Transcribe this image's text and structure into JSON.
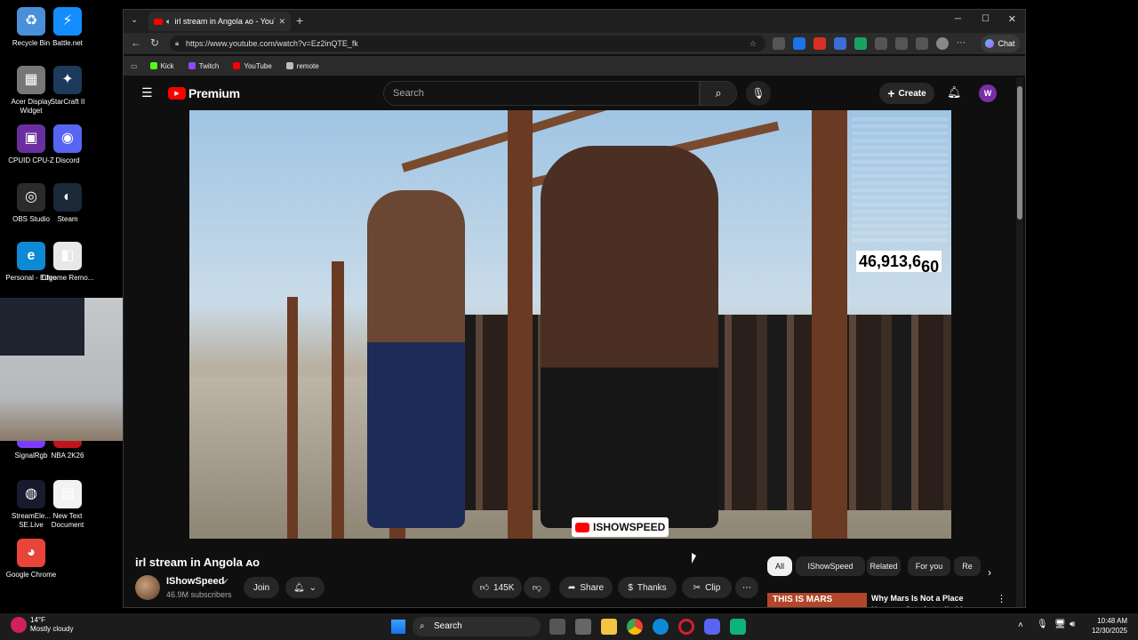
{
  "desktop": {
    "icons": [
      {
        "label": "Recycle Bin",
        "glyph": "♻",
        "color": "#4a90d9"
      },
      {
        "label": "Battle.net",
        "glyph": "⚡",
        "color": "#148eff"
      },
      {
        "label": "Acer Display Widget",
        "glyph": "▦",
        "color": "#777777"
      },
      {
        "label": "StarCraft II",
        "glyph": "✦",
        "color": "#1b3a5c"
      },
      {
        "label": "CPUID CPU-Z",
        "glyph": "▣",
        "color": "#6a2ea0"
      },
      {
        "label": "Discord",
        "glyph": "◉",
        "color": "#5865f2"
      },
      {
        "label": "OBS Studio",
        "glyph": "◎",
        "color": "#2b2b2b"
      },
      {
        "label": "Steam",
        "glyph": "◐",
        "color": "#1b2838"
      },
      {
        "label": "Personal - Edge",
        "glyph": "e",
        "color": "#0c8ad6"
      },
      {
        "label": "Chrome Remo...",
        "glyph": "◧",
        "color": "#e8e8e8"
      },
      {
        "label": "SignalRgb",
        "glyph": "◆",
        "color": "#7a3cff"
      },
      {
        "label": "NBA 2K26",
        "glyph": "▲",
        "color": "#c0141c"
      },
      {
        "label": "StreamEle... SE.Live",
        "glyph": "◍",
        "color": "#1a1a2e"
      },
      {
        "label": "New Text Document",
        "glyph": "▤",
        "color": "#f2f2f2"
      },
      {
        "label": "Google Chrome",
        "glyph": "◕",
        "color": "#e9443a"
      }
    ]
  },
  "browser": {
    "tab_title": "irl stream in Angola ᴀᴏ - YouT",
    "url": "https://www.youtube.com/watch?v=Ez2inQTE_fk",
    "chat_label": "Chat",
    "favorites": [
      {
        "label": "Kick",
        "color": "#53fc18"
      },
      {
        "label": "Twitch",
        "color": "#9146ff"
      },
      {
        "label": "YouTube",
        "color": "#ff0000"
      },
      {
        "label": "remote",
        "color": "#bbbbbb"
      }
    ]
  },
  "youtube": {
    "brand": "Premium",
    "search_placeholder": "Search",
    "create_label": "Create",
    "avatar_letter": "W",
    "video": {
      "viewer_count": "46,913,6",
      "viewer_count_tail": "60",
      "watermark": "ISHOWSPEED"
    },
    "title": "irl stream in Angola ᴀᴏ",
    "channel": "IShowSpeed",
    "subscribers": "46.9M subscribers",
    "join_label": "Join",
    "likes": "145K",
    "share_label": "Share",
    "thanks_label": "Thanks",
    "clip_label": "Clip",
    "chips": [
      "All",
      "IShowSpeed",
      "Related",
      "For you",
      "Re"
    ],
    "suggested": {
      "thumb_text": "THIS IS MARS",
      "title": "Why Mars Is Not a Place Humans Can Actually Live"
    }
  },
  "taskbar": {
    "weather_temp": "14°F",
    "weather_desc": "Mostly cloudy",
    "search_label": "Search",
    "time": "10:48 AM",
    "date": "12/30/2025"
  },
  "colors": {
    "accent": "#ff0000",
    "yt_bg": "#0f0f0f",
    "chip_active": "#f1f1f1"
  }
}
